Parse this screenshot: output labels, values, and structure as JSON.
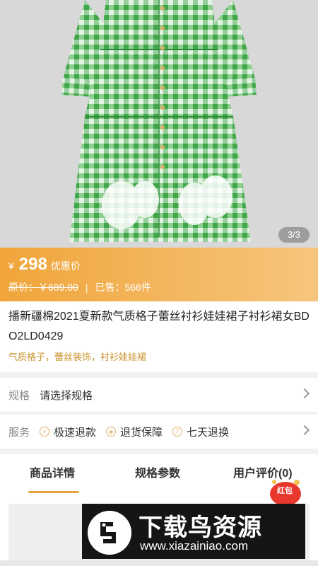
{
  "gallery": {
    "counter": "3/3"
  },
  "price": {
    "currency": "¥",
    "value": "298",
    "tag": "优惠价",
    "original": "原价：￥689.00",
    "separator": "|",
    "sold": "已售：566件"
  },
  "product": {
    "title": "播新疆棉2021夏新款气质格子蕾丝衬衫娃娃裙子衬衫裙女BDO2LD0429",
    "subtitle": "气质格子，蕾丝装饰，衬衫娃娃裙"
  },
  "spec": {
    "label": "规格",
    "value": "请选择规格"
  },
  "service": {
    "label": "服务",
    "items": [
      {
        "icon": "lightning-icon",
        "label": "极速退款"
      },
      {
        "icon": "shield-icon",
        "label": "退货保障"
      },
      {
        "icon": "seven-day-icon",
        "label": "七天退换"
      }
    ]
  },
  "tabs": [
    "商品详情",
    "规格参数",
    "用户评价(0)"
  ],
  "redpacket": {
    "label": "红包"
  },
  "watermark": {
    "title": "下载鸟资源",
    "url": "www.xiazainiao.com"
  },
  "colors": {
    "accent": "#e8a040",
    "price_bg_start": "#f0a53a",
    "price_bg_end": "#f6c57d",
    "subtitle": "#c8922a"
  }
}
